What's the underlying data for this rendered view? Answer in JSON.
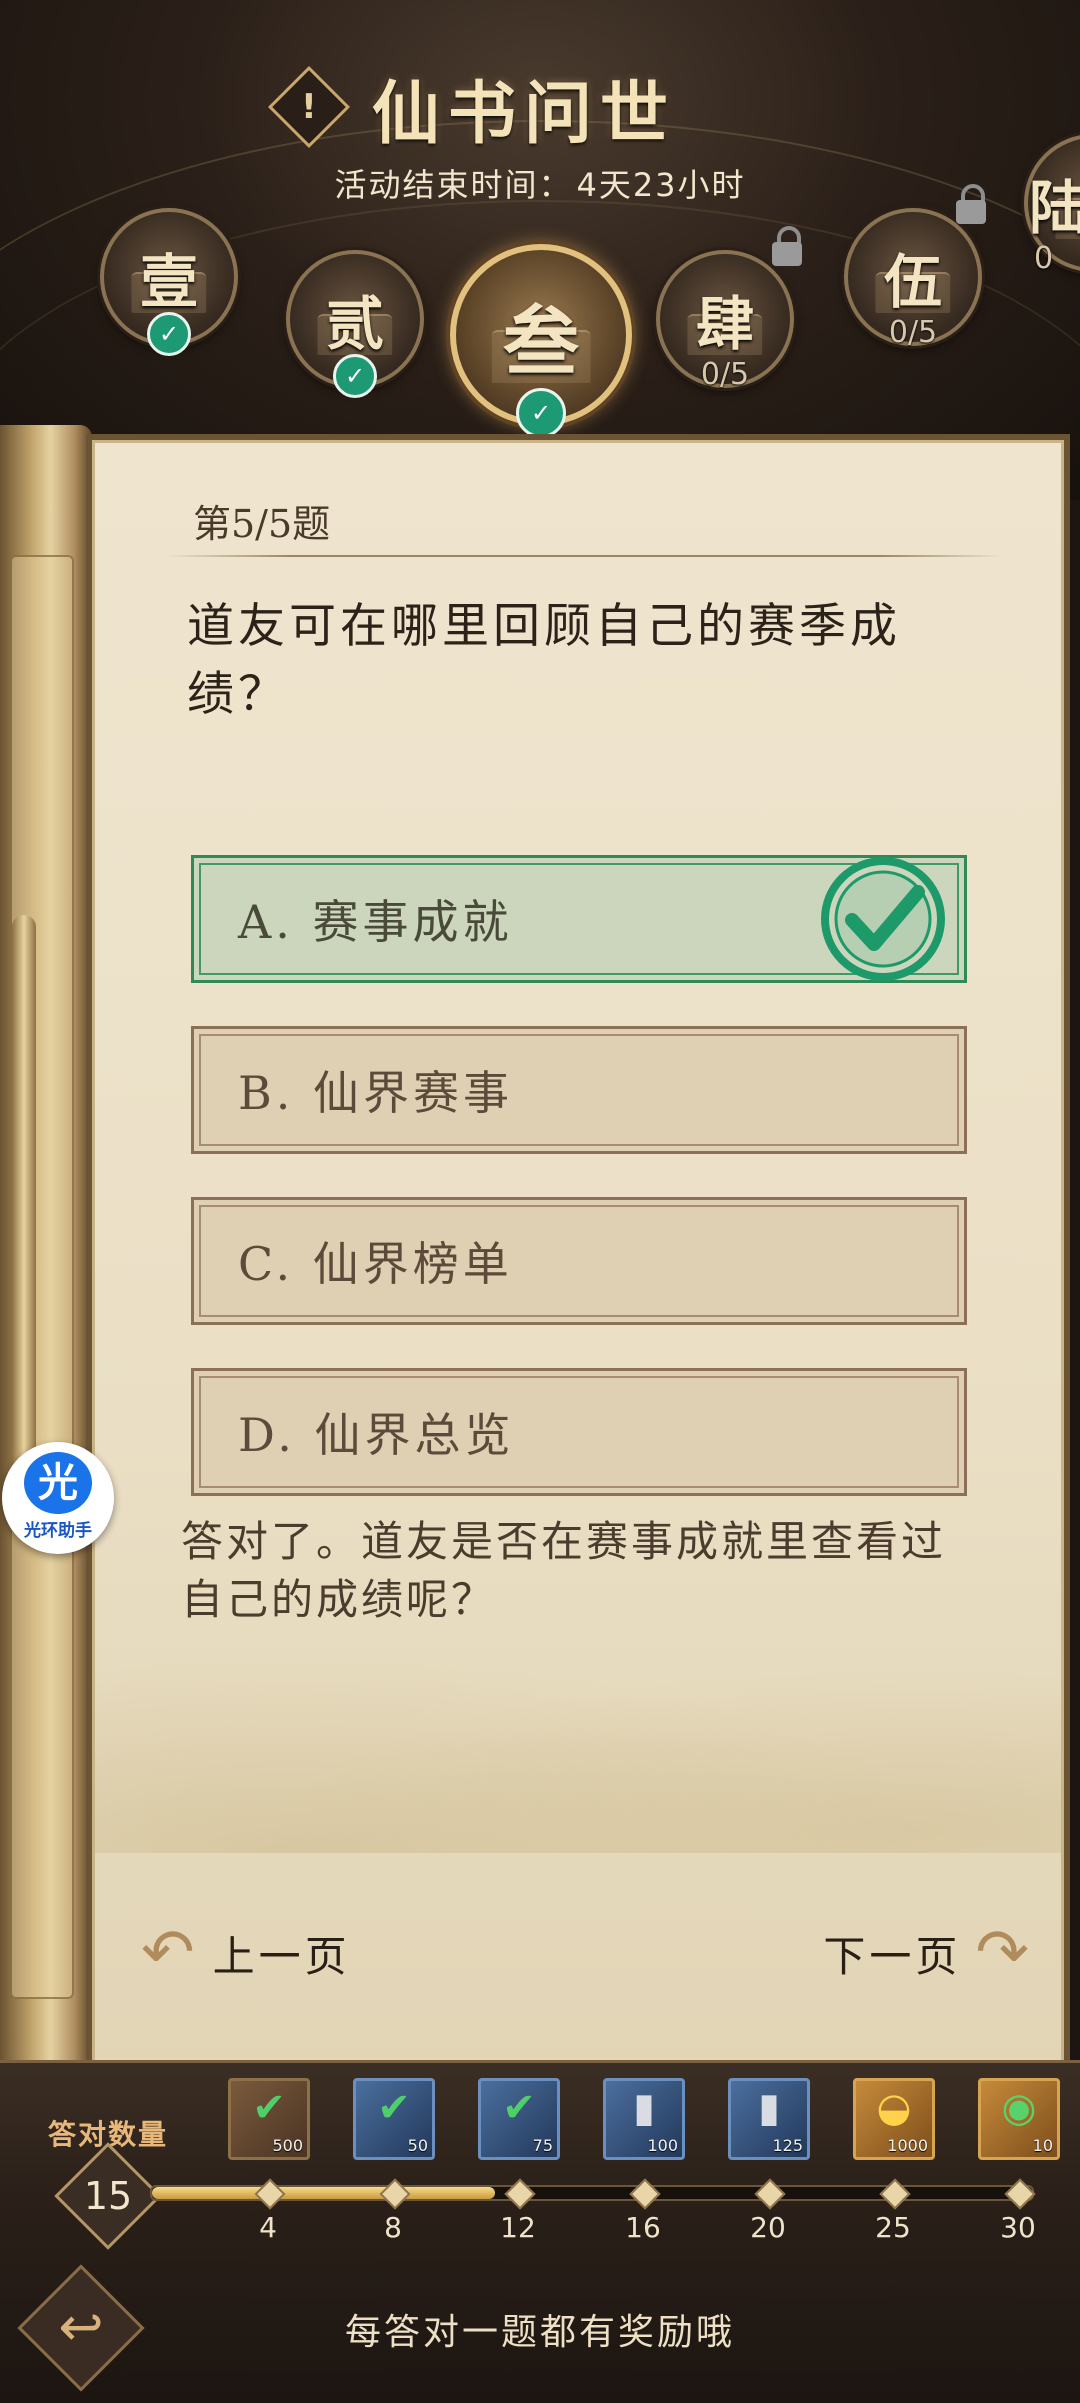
{
  "header": {
    "title": "仙书问世",
    "subtitle_label": "活动结束时间：",
    "subtitle_value": "4天23小时",
    "chapters": [
      {
        "label": "壹",
        "status": "completed"
      },
      {
        "label": "贰",
        "status": "completed"
      },
      {
        "label": "叁",
        "status": "completed",
        "active": true
      },
      {
        "label": "肆",
        "status": "locked",
        "progress": "0/5"
      },
      {
        "label": "伍",
        "status": "locked",
        "progress": "0/5"
      },
      {
        "label": "陆",
        "status": "locked",
        "progress": "0"
      }
    ]
  },
  "quiz": {
    "question_number": "第5/5题",
    "question": "道友可在哪里回顾自己的赛季成绩？",
    "options": [
      {
        "text": "A. 赛事成就",
        "correct": true
      },
      {
        "text": "B. 仙界赛事"
      },
      {
        "text": "C. 仙界榜单"
      },
      {
        "text": "D. 仙界总览"
      }
    ],
    "feedback": "答对了。道友是否在赛事成就里查看过自己的成绩呢？",
    "prev_label": "上一页",
    "next_label": "下一页"
  },
  "rewards": {
    "label": "答对数量",
    "correct_count": "15",
    "progress_fraction": 0.39,
    "milestones": [
      "4",
      "8",
      "12",
      "16",
      "20",
      "25",
      "30"
    ],
    "items": [
      {
        "icon": "green-banner-icon",
        "qty": "500",
        "color": "brown"
      },
      {
        "icon": "green-banner-icon",
        "qty": "50",
        "color": "blue"
      },
      {
        "icon": "green-banner-icon",
        "qty": "75",
        "color": "blue"
      },
      {
        "icon": "silver-ingot-icon",
        "qty": "100",
        "color": "blue"
      },
      {
        "icon": "silver-ingot-icon",
        "qty": "125",
        "color": "blue"
      },
      {
        "icon": "gold-ingot-icon",
        "qty": "1000",
        "color": "gold"
      },
      {
        "icon": "jade-dragon-icon",
        "qty": "10",
        "color": "gold"
      }
    ],
    "footer_hint": "每答对一题都有奖励哦"
  },
  "helper": {
    "icon_text": "光",
    "label": "光环助手"
  },
  "colors": {
    "correct_green": "#2f8a57",
    "gold_accent": "#e2c07d",
    "paper": "#ebe0c6"
  }
}
